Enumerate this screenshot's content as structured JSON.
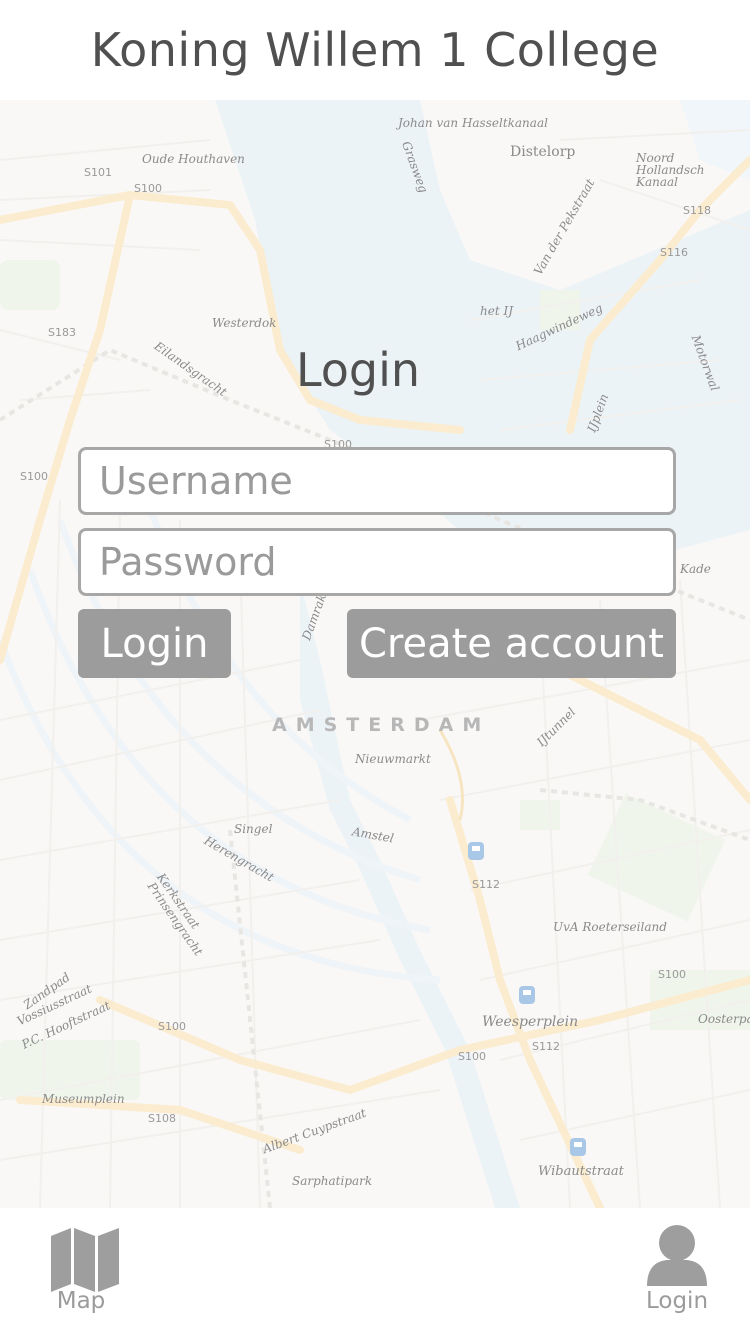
{
  "header": {
    "title": "Koning Willem 1 College"
  },
  "map": {
    "city_label": "AMSTERDAM",
    "labels": [
      "Johan van Hasseltkanaal",
      "Distelorp",
      "Noord Hollandsch Kanaal",
      "Oude Houthaven",
      "Grasweg",
      "Van der Pekstraat",
      "S118",
      "S101",
      "S100",
      "S116",
      "Westerdok",
      "het IJ",
      "Haagwindeweg",
      "S183",
      "Eilandsgracht",
      "Motorwal",
      "IJplein",
      "Damrak",
      "Kade",
      "S100",
      "Nieuwmarkt",
      "IJtunnel",
      "Singel",
      "Amstel",
      "Herengracht",
      "Kerkstraat",
      "Prinsengracht",
      "S112",
      "UvA Roeterseiland",
      "Zandpad",
      "Vossiusstraat",
      "P.C. Hooftstraat",
      "S100",
      "Weesperplein",
      "Oosterpark",
      "S112",
      "Museumplein",
      "S108",
      "Albert Cuypstraat",
      "Wibautstraat",
      "Sarphatipark",
      "S100",
      "S100",
      "S100"
    ]
  },
  "login": {
    "title": "Login",
    "username_placeholder": "Username",
    "password_placeholder": "Password",
    "login_button": "Login",
    "create_button": "Create account"
  },
  "tabbar": {
    "items": [
      {
        "label": "Map",
        "icon": "map-icon"
      },
      {
        "label": "Login",
        "icon": "user-icon"
      }
    ]
  },
  "colors": {
    "button": "#9c9c9c",
    "border": "#a7a7a7",
    "water": "#dde9f1",
    "road": "#f7dca8",
    "text": "#505050"
  }
}
